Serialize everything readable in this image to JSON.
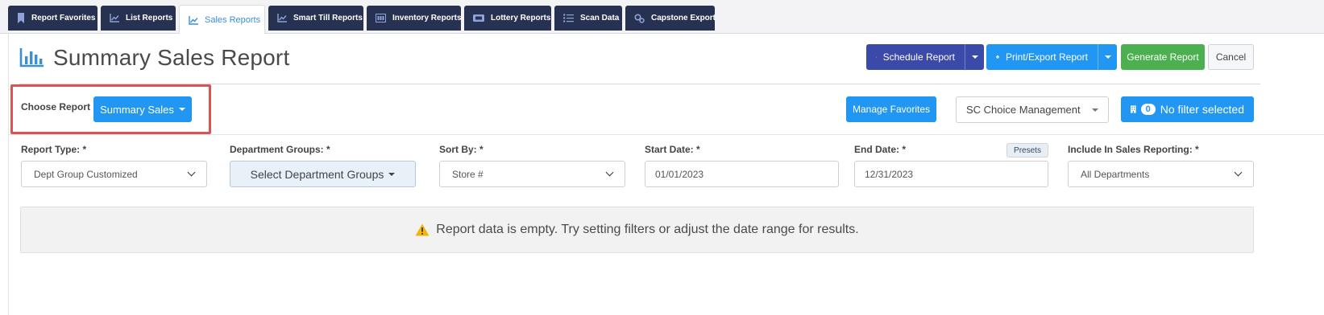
{
  "tabs": [
    {
      "label": "Report Favorites",
      "icon": "bookmark-icon",
      "active": false
    },
    {
      "label": "List Reports",
      "icon": "line-chart-icon",
      "active": false
    },
    {
      "label": "Sales Reports",
      "icon": "line-chart-icon",
      "active": true
    },
    {
      "label": "Smart Till Reports",
      "icon": "line-chart-icon",
      "active": false
    },
    {
      "label": "Inventory Reports",
      "icon": "inventory-icon",
      "active": false
    },
    {
      "label": "Lottery Reports",
      "icon": "ticket-icon",
      "active": false
    },
    {
      "label": "Scan Data",
      "icon": "list-icon",
      "active": false
    },
    {
      "label": "Capstone Export",
      "icon": "gears-icon",
      "active": false
    }
  ],
  "page": {
    "title": "Summary Sales Report"
  },
  "actions": {
    "schedule": "Schedule Report",
    "print_export": "Print/Export Report",
    "generate": "Generate Report",
    "cancel": "Cancel"
  },
  "report_bar": {
    "choose_label": "Choose Report",
    "choose_value": "Summary Sales",
    "manage_favorites": "Manage Favorites",
    "store_select": "SC Choice Management",
    "filter_count": "0",
    "filter_text": "No filter selected"
  },
  "filters": {
    "report_type": {
      "label": "Report Type: *",
      "value": "Dept Group Customized"
    },
    "dept_groups": {
      "label": "Department Groups: *",
      "value": "Select Department Groups"
    },
    "sort_by": {
      "label": "Sort By: *",
      "value": "Store #"
    },
    "start_date": {
      "label": "Start Date: *",
      "value": "01/01/2023"
    },
    "end_date": {
      "label": "End Date: *",
      "value": "12/31/2023"
    },
    "presets": "Presets",
    "include_sales": {
      "label": "Include In Sales Reporting: *",
      "value": "All Departments"
    }
  },
  "message": {
    "empty": "Report data is empty. Try setting filters or adjust the date range for results."
  },
  "colors": {
    "navy_tab": "#273151",
    "schedule_btn": "#3b4aa8",
    "blue_btn": "#2196f3",
    "green_btn": "#4caf50",
    "highlight_red": "#e05252",
    "warning_yellow": "#f2b705"
  }
}
